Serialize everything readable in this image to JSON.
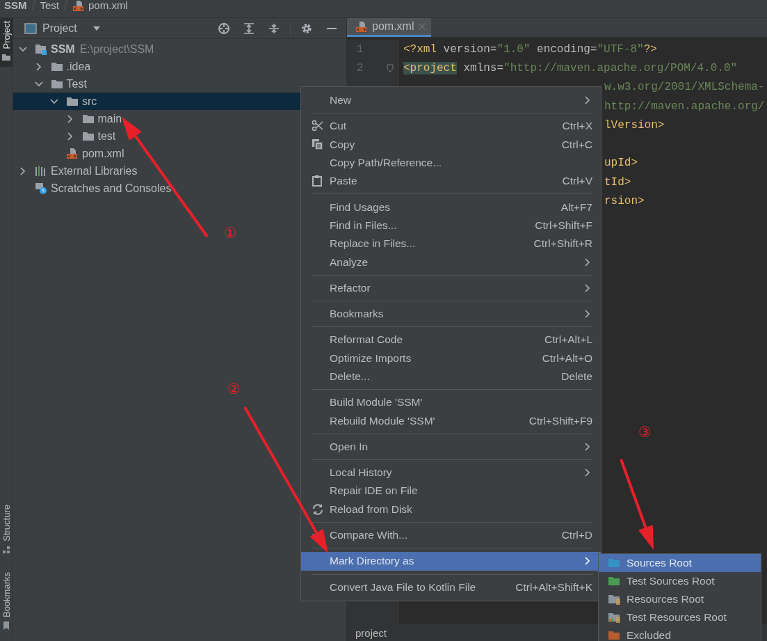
{
  "breadcrumb": [
    {
      "label": "SSM",
      "kind": "bold"
    },
    {
      "label": "Test",
      "kind": "plain"
    },
    {
      "label": "pom.xml",
      "kind": "file"
    }
  ],
  "side_tabs": [
    {
      "label": "Project",
      "selected": true
    },
    {
      "label": "Structure",
      "selected": false
    },
    {
      "label": "Bookmarks",
      "selected": false
    }
  ],
  "project_panel": {
    "title": "Project",
    "tree": [
      {
        "label": "SSM",
        "detail": "E:\\project\\SSM",
        "kind": "module",
        "expanded": true,
        "selected": false,
        "children": [
          {
            "label": ".idea",
            "kind": "folder",
            "expanded": false,
            "selected": false
          },
          {
            "label": "Test",
            "kind": "folder",
            "expanded": true,
            "selected": false,
            "children": [
              {
                "label": "src",
                "kind": "folder",
                "expanded": true,
                "selected": true,
                "children": [
                  {
                    "label": "main",
                    "kind": "folder",
                    "expanded": false,
                    "selected": false
                  },
                  {
                    "label": "test",
                    "kind": "folder",
                    "expanded": false,
                    "selected": false
                  }
                ]
              },
              {
                "label": "pom.xml",
                "kind": "xml",
                "selected": false
              }
            ]
          }
        ]
      },
      {
        "label": "External Libraries",
        "kind": "libraries",
        "expanded": false,
        "selected": false
      },
      {
        "label": "Scratches and Consoles",
        "kind": "scratches",
        "selected": false
      }
    ]
  },
  "editor": {
    "tabs": [
      {
        "label": "pom.xml",
        "selected": true
      }
    ],
    "lines": [
      {
        "kind": "full",
        "number": "1",
        "segments": [
          {
            "kind": "tag",
            "text": "<?xml "
          },
          {
            "kind": "attr",
            "text": "version="
          },
          {
            "kind": "value",
            "text": "\"1.0\" "
          },
          {
            "kind": "attr",
            "text": "encoding="
          },
          {
            "kind": "value",
            "text": "\"UTF-8\""
          },
          {
            "kind": "tag",
            "text": "?>"
          }
        ]
      },
      {
        "kind": "full",
        "number": "2",
        "segments": [
          {
            "kind": "tag-match",
            "text": "<project"
          },
          {
            "kind": "attr",
            "text": " xmlns="
          },
          {
            "kind": "value",
            "text": "\"http://maven.apache.org/POM/4.0.0\""
          }
        ]
      },
      {
        "kind": "fragment",
        "segments": [
          {
            "kind": "value",
            "text": "w.w3.org/2001/XMLSchema-"
          }
        ]
      },
      {
        "kind": "fragment",
        "segments": [
          {
            "kind": "value",
            "text": "http://maven.apache.org/"
          }
        ]
      },
      {
        "kind": "fragment",
        "segments": [
          {
            "kind": "tag",
            "text": "lVersion>"
          }
        ]
      },
      {
        "kind": "blank"
      },
      {
        "kind": "fragment",
        "segments": [
          {
            "kind": "tag",
            "text": "upId>"
          }
        ]
      },
      {
        "kind": "fragment",
        "segments": [
          {
            "kind": "tag",
            "text": "tId>"
          }
        ]
      },
      {
        "kind": "fragment",
        "segments": [
          {
            "kind": "tag",
            "text": "rsion>"
          }
        ]
      }
    ],
    "path": "project"
  },
  "context_menu": {
    "groups": [
      [
        {
          "label": "New",
          "has_submenu": true,
          "selected": false
        }
      ],
      [
        {
          "label": "Cut",
          "kind": "scissors",
          "shortcut": "Ctrl+X",
          "has_submenu": false,
          "selected": false
        },
        {
          "label": "Copy",
          "kind": "copy",
          "shortcut": "Ctrl+C",
          "has_submenu": false,
          "selected": false
        },
        {
          "label": "Copy Path/Reference...",
          "has_submenu": false,
          "selected": false
        },
        {
          "label": "Paste",
          "kind": "paste",
          "shortcut": "Ctrl+V",
          "has_submenu": false,
          "selected": false
        }
      ],
      [
        {
          "label": "Find Usages",
          "shortcut": "Alt+F7",
          "has_submenu": false,
          "selected": false
        },
        {
          "label": "Find in Files...",
          "shortcut": "Ctrl+Shift+F",
          "has_submenu": false,
          "selected": false
        },
        {
          "label": "Replace in Files...",
          "shortcut": "Ctrl+Shift+R",
          "has_submenu": false,
          "selected": false
        },
        {
          "label": "Analyze",
          "has_submenu": true,
          "selected": false
        }
      ],
      [
        {
          "label": "Refactor",
          "has_submenu": true,
          "selected": false
        }
      ],
      [
        {
          "label": "Bookmarks",
          "has_submenu": true,
          "selected": false
        }
      ],
      [
        {
          "label": "Reformat Code",
          "shortcut": "Ctrl+Alt+L",
          "has_submenu": false,
          "selected": false
        },
        {
          "label": "Optimize Imports",
          "shortcut": "Ctrl+Alt+O",
          "has_submenu": false,
          "selected": false
        },
        {
          "label": "Delete...",
          "shortcut": "Delete",
          "has_submenu": false,
          "selected": false
        }
      ],
      [
        {
          "label": "Build Module 'SSM'",
          "has_submenu": false,
          "selected": false
        },
        {
          "label": "Rebuild Module 'SSM'",
          "shortcut": "Ctrl+Shift+F9",
          "has_submenu": false,
          "selected": false
        }
      ],
      [
        {
          "label": "Open In",
          "has_submenu": true,
          "selected": false
        }
      ],
      [
        {
          "label": "Local History",
          "has_submenu": true,
          "selected": false
        },
        {
          "label": "Repair IDE on File",
          "has_submenu": false,
          "selected": false
        },
        {
          "label": "Reload from Disk",
          "kind": "reload",
          "has_submenu": false,
          "selected": false
        }
      ],
      [
        {
          "label": "Compare With...",
          "kind": "compare",
          "shortcut": "Ctrl+D",
          "has_submenu": false,
          "selected": false
        }
      ],
      [
        {
          "label": "Mark Directory as",
          "has_submenu": true,
          "selected": true
        }
      ],
      [
        {
          "label": "Convert Java File to Kotlin File",
          "shortcut": "Ctrl+Alt+Shift+K",
          "has_submenu": false,
          "selected": false
        }
      ]
    ]
  },
  "submenu": {
    "items": [
      {
        "label": "Sources Root",
        "kind": "folder",
        "color": "#3592c4",
        "selected": true
      },
      {
        "label": "Test Sources Root",
        "kind": "folder",
        "color": "#499c54",
        "selected": false
      },
      {
        "label": "Resources Root",
        "kind": "resources",
        "color": "#8c949c",
        "selected": false
      },
      {
        "label": "Test Resources Root",
        "kind": "test-resources",
        "color": "#8c949c",
        "selected": false
      },
      {
        "label": "Excluded",
        "kind": "folder",
        "color": "#b65c2e",
        "selected": false
      }
    ]
  },
  "annotations": [
    {
      "label": "①"
    },
    {
      "label": "②"
    },
    {
      "label": "③"
    }
  ]
}
